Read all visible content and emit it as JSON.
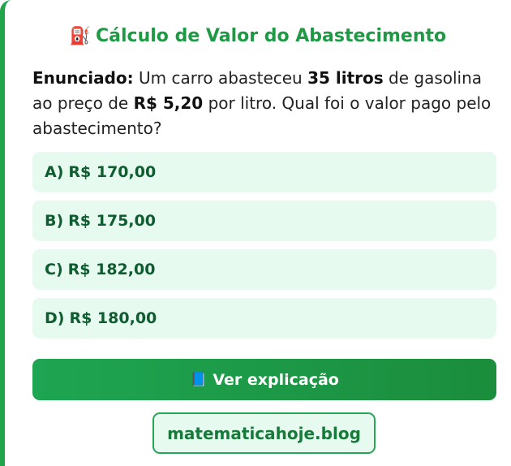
{
  "title": {
    "icon": "fuel-pump-icon",
    "icon_glyph": "⛽",
    "text": "Cálculo de Valor do Abastecimento"
  },
  "statement": {
    "label": "Enunciado:",
    "part1": " Um carro abasteceu ",
    "bold1": "35 litros",
    "part2": " de gasolina ao preço de ",
    "bold2": "R$ 5,20",
    "part3": " por litro. Qual foi o valor pago pelo abastecimento?"
  },
  "options": [
    {
      "letter": "A)",
      "value": "R$ 170,00"
    },
    {
      "letter": "B)",
      "value": "R$ 175,00"
    },
    {
      "letter": "C)",
      "value": "R$ 182,00"
    },
    {
      "letter": "D)",
      "value": "R$ 180,00"
    }
  ],
  "explain_button": {
    "icon": "book-icon",
    "icon_glyph": "📘",
    "label": "Ver explicação"
  },
  "site_link": {
    "label": "matematicahoje.blog"
  },
  "colors": {
    "accent_green": "#1e9a45",
    "option_bg": "#e6faf0",
    "option_text": "#0f5c30",
    "button_bg": "#1ea552"
  }
}
